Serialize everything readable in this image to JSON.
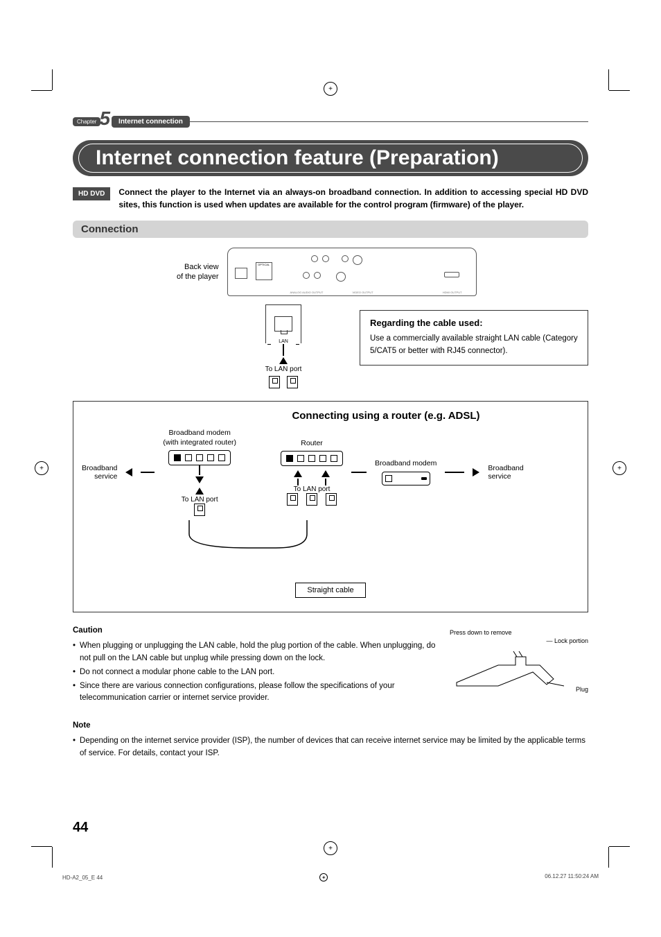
{
  "chapter": {
    "label": "Chapter",
    "number": "5",
    "title": "Internet connection"
  },
  "main_title": "Internet connection feature (Preparation)",
  "badge": "HD DVD",
  "intro": "Connect the player to the Internet via an always-on broadband connection. In addition to accessing special HD DVD sites, this function is used when updates are available for the control program (firmware) of the player.",
  "section_connection": "Connection",
  "backview": {
    "line1": "Back view",
    "line2": "of the player"
  },
  "lan_label": "LAN",
  "cable_box": {
    "title": "Regarding the cable used:",
    "text": "Use a commercially available straight LAN cable (Category 5/CAT5 or better with RJ45 connector)."
  },
  "to_lan": "To LAN port",
  "router_section": {
    "title": "Connecting using a router (e.g. ADSL)",
    "modem_integrated": {
      "line1": "Broadband modem",
      "line2": "(with integrated router)"
    },
    "router_label": "Router",
    "modem_label": "Broadband modem",
    "broadband_service": {
      "line1": "Broadband",
      "line2": "service"
    },
    "straight_cable": "Straight cable"
  },
  "caution": {
    "heading": "Caution",
    "b1": "When plugging or unplugging the LAN cable, hold the plug portion of the cable. When unplugging, do not pull on the LAN cable but unplug while pressing down on the lock.",
    "b2": "Do not connect a modular phone cable to the LAN port.",
    "b3": "Since there are various connection configurations, please follow the specifications of your telecommunication carrier or internet service provider."
  },
  "plug_diagram": {
    "press": "Press down to remove",
    "lock": "Lock portion",
    "plug": "Plug"
  },
  "note": {
    "heading": "Note",
    "text": "Depending on the internet service provider (ISP), the number of devices that can receive internet service may be limited by the applicable terms of service. For details, contact your ISP."
  },
  "page_number": "44",
  "footer": {
    "left": "HD-A2_05_E   44",
    "right": "06.12.27   11:50:24 AM"
  }
}
